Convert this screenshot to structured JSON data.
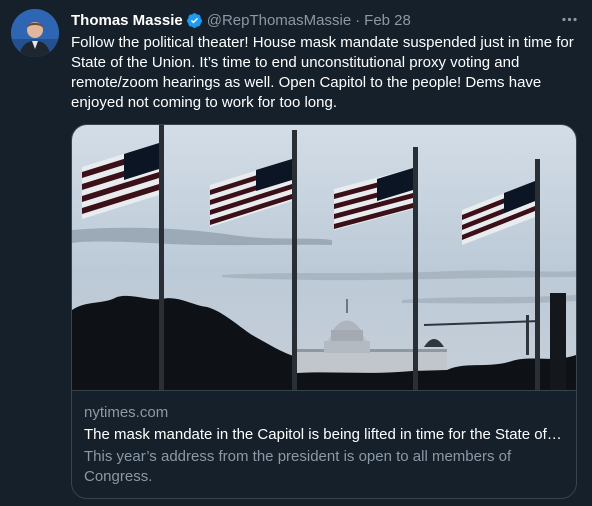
{
  "colors": {
    "background": "#15202b",
    "verified_badge": "#1d9bf0",
    "secondary_text": "#8b98a5",
    "border": "#38444d"
  },
  "tweet": {
    "author": {
      "display_name": "Thomas Massie",
      "handle": "@RepThomasMassie",
      "verified": true,
      "avatar_icon": "user-photo-avatar"
    },
    "separator": "·",
    "date": "Feb 28",
    "more_icon": "more-horizontal-icon",
    "text": "Follow the political theater! House mask mandate suspended just in time for State of the Union. It’s time to end unconstitutional proxy voting and remote/zoom hearings as well. Open Capitol to the people! Dems have enjoyed not coming to work for too long.",
    "link_card": {
      "image_icon": "us-capitol-flags-photo",
      "domain": "nytimes.com",
      "title": "The mask mandate in the Capitol is being lifted in time for the State of the Union.",
      "description": "This year’s address from the president is open to all members of Congress."
    }
  }
}
